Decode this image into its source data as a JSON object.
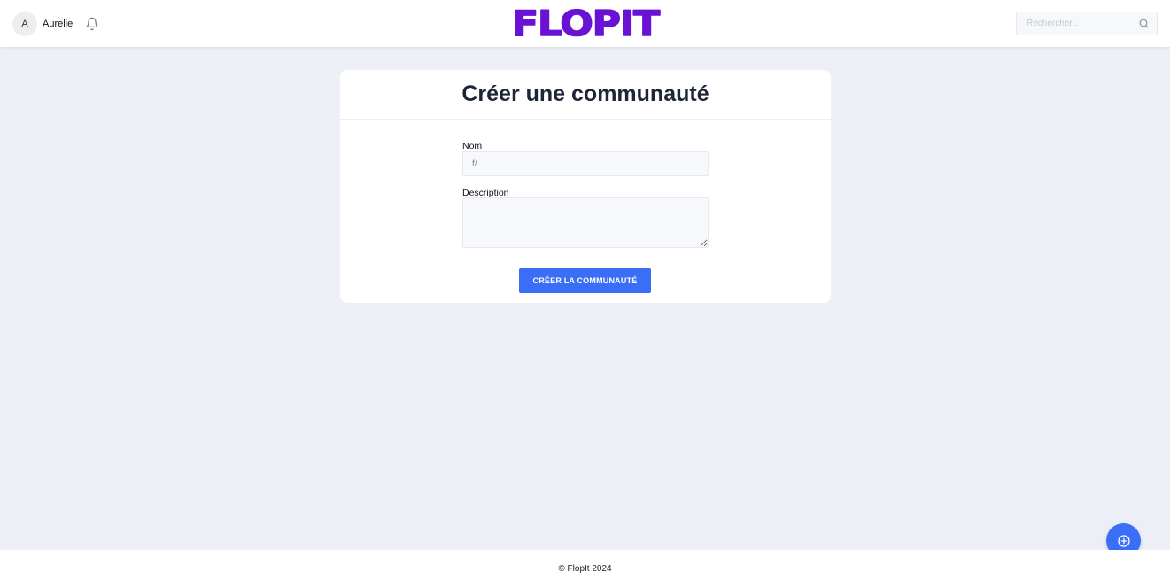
{
  "header": {
    "user": {
      "initial": "A",
      "name": "Aurelie"
    },
    "logo_text": "FLOPIT",
    "search": {
      "placeholder": "Rechercher...",
      "value": ""
    },
    "icons": {
      "notification": "bell-icon",
      "search": "search-icon"
    }
  },
  "form": {
    "title": "Créer une communauté",
    "name_label": "Nom",
    "name_value": "f/",
    "description_label": "Description",
    "description_value": "",
    "submit_label": "CRÉER LA COMMUNAUTÉ"
  },
  "fab": {
    "icon": "plus-circle-icon"
  },
  "footer": {
    "text": "© FlopIt 2024"
  },
  "colors": {
    "brand": "#6a12d4",
    "accent": "#3b6ef6",
    "background": "#eceff6",
    "title": "#1e2538"
  }
}
